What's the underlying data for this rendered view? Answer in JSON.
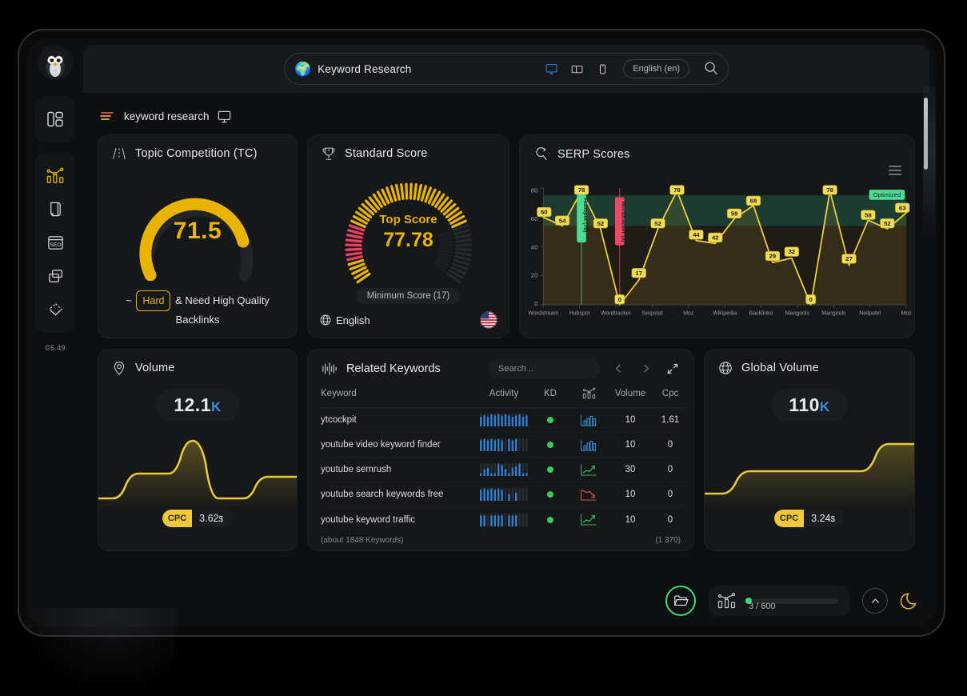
{
  "topbar": {
    "globe_icon": "globe-emoji",
    "title": "Keyword Research",
    "devices": [
      {
        "name": "desktop",
        "active": true
      },
      {
        "name": "tablet",
        "active": false
      },
      {
        "name": "mobile",
        "active": false
      }
    ],
    "language_chip": "English (en)",
    "search_icon": "search-icon"
  },
  "sidebar": {
    "avatar": "penguin-avatar",
    "items": [
      {
        "name": "dashboard-icon",
        "active": false
      },
      {
        "name": "analytics-icon",
        "active": true
      },
      {
        "name": "document-icon",
        "active": false
      },
      {
        "name": "seo-icon",
        "label": "SEO",
        "active": false
      },
      {
        "name": "layers-icon",
        "active": false
      },
      {
        "name": "diamond-icon",
        "active": false
      }
    ],
    "version": "©5.49"
  },
  "breadcrumb": {
    "text": "keyword research",
    "device_icon": "desktop-icon"
  },
  "topic_competition": {
    "title": "Topic Competition (TC)",
    "icon": "road-icon",
    "value": "71.5",
    "value_number": 71.5,
    "max": 100,
    "caption_prefix": "~",
    "difficulty_chip": "Hard",
    "caption_suffix": "& Need High Quality Backlinks",
    "accent_color": "#e8b400"
  },
  "standard_score": {
    "title": "Standard Score",
    "icon": "trophy-icon",
    "top_label": "Top Score",
    "value": "77.78",
    "value_number": 77.78,
    "minimum_score_label": "Minimum Score (17)",
    "minimum_score": 17,
    "language": "English",
    "flag": "us-flag",
    "accent_color": "#e8b400",
    "min_marker_color": "#ec3f63"
  },
  "serp": {
    "title": "SERP Scores",
    "icon": "serp-search-icon",
    "menu_icon": "hamburger-menu-icon",
    "optimized_badge": "Optimized"
  },
  "volume": {
    "title": "Volume",
    "icon": "location-pin-icon",
    "value": "12.1",
    "unit": "K",
    "cpc_tag": "CPC",
    "cpc_value": "3.62",
    "cpc_currency": "$"
  },
  "global_volume": {
    "title": "Global Volume",
    "icon": "globe-icon",
    "value": "110",
    "unit": "K",
    "cpc_tag": "CPC",
    "cpc_value": "3.24",
    "cpc_currency": "$"
  },
  "related_keywords": {
    "title": "Related Keywords",
    "icon": "waveform-icon",
    "search_placeholder": "Search ..",
    "prev_icon": "chevron-left-icon",
    "next_icon": "chevron-right-icon",
    "expand_icon": "expand-icon",
    "columns": [
      "Keyword",
      "Activity",
      "KD",
      "",
      "Volume",
      "Cpc"
    ],
    "rows": [
      {
        "keyword": "ytcockpit",
        "activity": [
          7,
          8,
          7,
          9,
          8,
          9,
          8,
          9,
          8,
          7,
          8,
          9,
          7,
          8
        ],
        "kd": "green",
        "trend": "bars-blue",
        "volume": "10",
        "cpc": "1.61"
      },
      {
        "keyword": "youtube video keyword finder",
        "activity": [
          8,
          9,
          8,
          9,
          8,
          9,
          8,
          0,
          9,
          8,
          9,
          0,
          0,
          0
        ],
        "kd": "green",
        "trend": "bars-blue",
        "volume": "10",
        "cpc": "0"
      },
      {
        "keyword": "youtube semrush",
        "activity": [
          2,
          5,
          6,
          2,
          2,
          9,
          8,
          5,
          2,
          6,
          7,
          9,
          2,
          2
        ],
        "kd": "green",
        "trend": "line-up-green",
        "volume": "30",
        "cpc": "0"
      },
      {
        "keyword": "youtube search keywords free",
        "activity": [
          8,
          9,
          8,
          9,
          8,
          9,
          8,
          0,
          5,
          0,
          6,
          0,
          0,
          0
        ],
        "kd": "green",
        "trend": "line-down-red",
        "volume": "10",
        "cpc": "0"
      },
      {
        "keyword": "youtube keyword traffic",
        "activity": [
          8,
          8,
          0,
          8,
          8,
          8,
          8,
          0,
          8,
          8,
          8,
          0,
          0,
          0
        ],
        "kd": "green",
        "trend": "line-up-green",
        "volume": "10",
        "cpc": "0"
      }
    ],
    "footer_left": "(about 1848 Keywords)",
    "footer_right": "(1 370)"
  },
  "dock": {
    "folder_icon": "folder-icon",
    "analytics_icon": "analytics-icon",
    "usage_text": "3 / 600",
    "usage_current": 3,
    "usage_max": 600,
    "up_icon": "chevron-up-icon",
    "moon_icon": "moon-icon"
  },
  "chart_data": {
    "type": "line",
    "title": "SERP Scores",
    "x": [
      "Wordstream",
      "Wordstream",
      "Hubspot",
      "Hubspot",
      "Wordtracker",
      "Wordtracker",
      "Serpstat",
      "Serpstat",
      "Moz",
      "Wikipedia",
      "Wikipedia",
      "Backlinko",
      "Backlinko",
      "Mangools",
      "Mangools",
      "Mangools",
      "Mangools",
      "Neilpatel",
      "Neilpatel",
      "Moz"
    ],
    "values": [
      60,
      54,
      78,
      52,
      0,
      17,
      52,
      78,
      44,
      42,
      59,
      68,
      29,
      32,
      0,
      78,
      27,
      58,
      52,
      63
    ],
    "tick_labels": [
      "Wordstream",
      "Hubspot",
      "Wordtracker",
      "Serpstat",
      "Moz",
      "Wikipedia",
      "Backlinko",
      "Mangools",
      "Mangools",
      "Neilpatel",
      "Moz"
    ],
    "ylabel": "",
    "xlabel": "",
    "ylim": [
      0,
      80
    ],
    "yticks": [
      0,
      20,
      40,
      60,
      80
    ],
    "grid": false,
    "line_color": "#f0d040",
    "band": {
      "from": 54,
      "to": 75,
      "color": "#1f4a39",
      "label": "Optimized"
    },
    "annotations": [
      {
        "label": "Hubspot (78)",
        "x_index": 2,
        "value": 78,
        "color": "#4ddb94",
        "type": "best"
      },
      {
        "label": "Wordtracker (0)",
        "x_index": 4,
        "value": 0,
        "color": "#ee4868",
        "type": "worst"
      }
    ],
    "legend_position": "none"
  }
}
